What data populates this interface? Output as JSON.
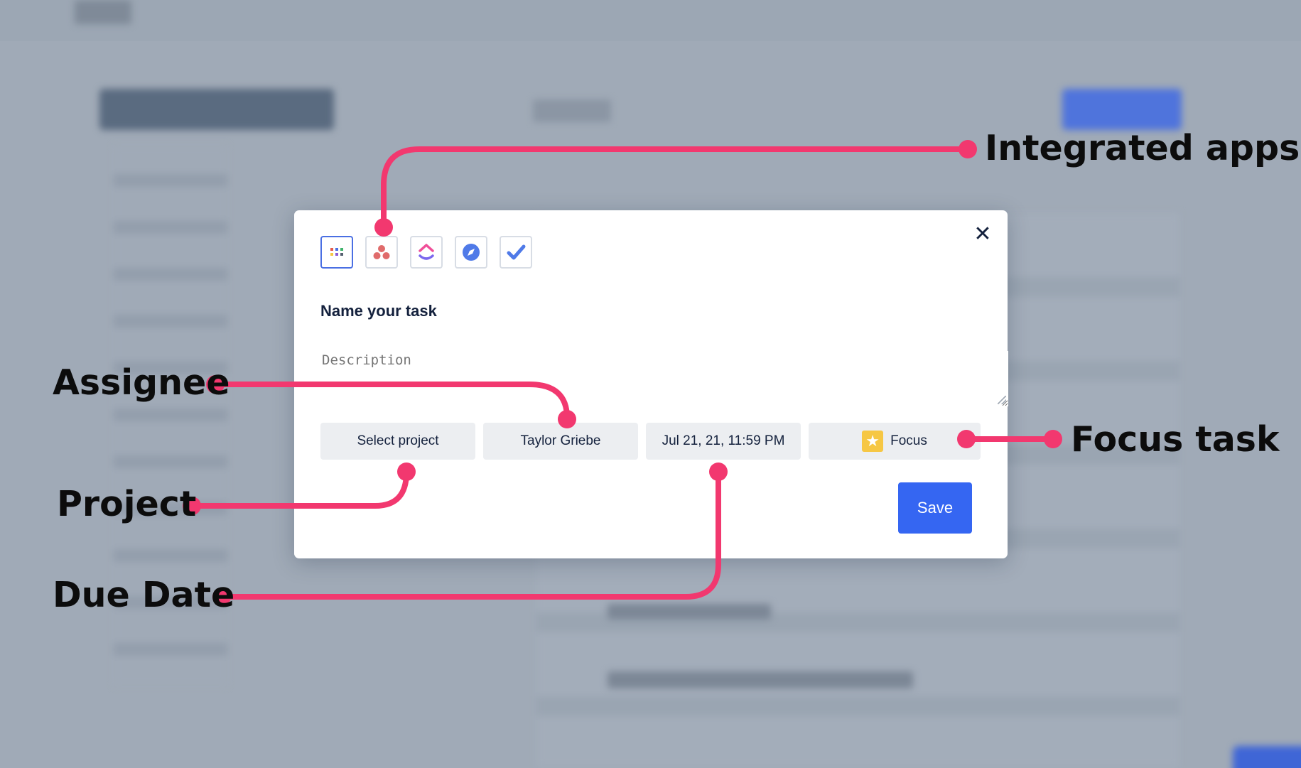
{
  "modal": {
    "close_symbol": "✕",
    "apps": [
      {
        "name": "grid-app-icon",
        "active": true
      },
      {
        "name": "asana-icon",
        "active": false
      },
      {
        "name": "clickup-icon",
        "active": false
      },
      {
        "name": "compass-icon",
        "active": false
      },
      {
        "name": "checkmark-app-icon",
        "active": false
      }
    ],
    "task_title": "Name your task",
    "description_placeholder": "Description",
    "chips": {
      "project": "Select project",
      "assignee": "Taylor Griebe",
      "due_date": "Jul 21, 21, 11:59 PM",
      "focus": "Focus"
    },
    "save_label": "Save"
  },
  "annotations": {
    "integrated_apps": "Integrated apps",
    "assignee": "Assignee",
    "project": "Project",
    "due_date": "Due Date",
    "focus_task": "Focus task"
  },
  "colors": {
    "callout": "#f2386f",
    "accent": "#3566f2",
    "focus_star": "#f6c744"
  }
}
